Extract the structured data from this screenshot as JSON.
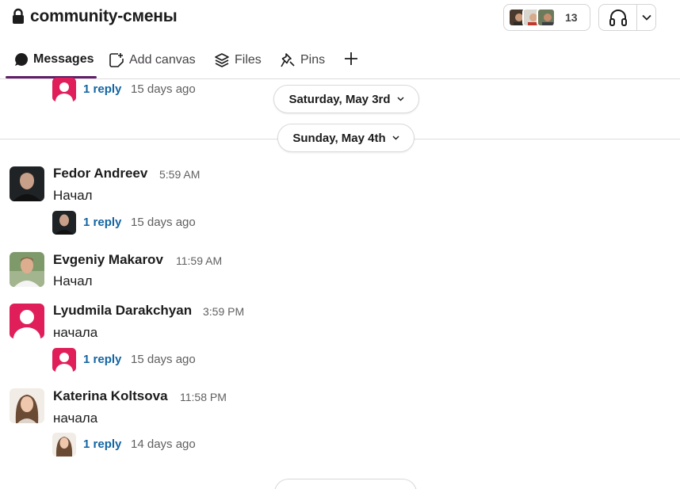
{
  "channel": {
    "name": "community-смены",
    "member_count": "13"
  },
  "tabs": [
    {
      "label": "Messages",
      "icon": "message-icon",
      "active": true
    },
    {
      "label": "Add canvas",
      "icon": "canvas-add-icon"
    },
    {
      "label": "Files",
      "icon": "files-stack-icon"
    },
    {
      "label": "Pins",
      "icon": "pin-icon"
    }
  ],
  "date_pills": [
    "Saturday, May 3rd",
    "Sunday, May 4th"
  ],
  "messages": [
    {
      "reply_label": "1 reply",
      "reply_age": "15 days ago"
    },
    {
      "sender": "Fedor Andreev",
      "time": "5:59 AM",
      "text": "Начал",
      "reply_label": "1 reply",
      "reply_age": "15 days ago"
    },
    {
      "sender": "Evgeniy Makarov",
      "time": "11:59 AM",
      "text": "Начал"
    },
    {
      "sender": "Lyudmila Darakchyan",
      "time": "3:59 PM",
      "text": "начала",
      "reply_label": "1 reply",
      "reply_age": "15 days ago"
    },
    {
      "sender": "Katerina Koltsova",
      "time": "11:58 PM",
      "text": "начала",
      "reply_label": "1 reply",
      "reply_age": "14 days ago"
    }
  ],
  "colors": {
    "accent": "#611f69",
    "link": "#1264a3",
    "default_avatar": "#e01e5a"
  }
}
